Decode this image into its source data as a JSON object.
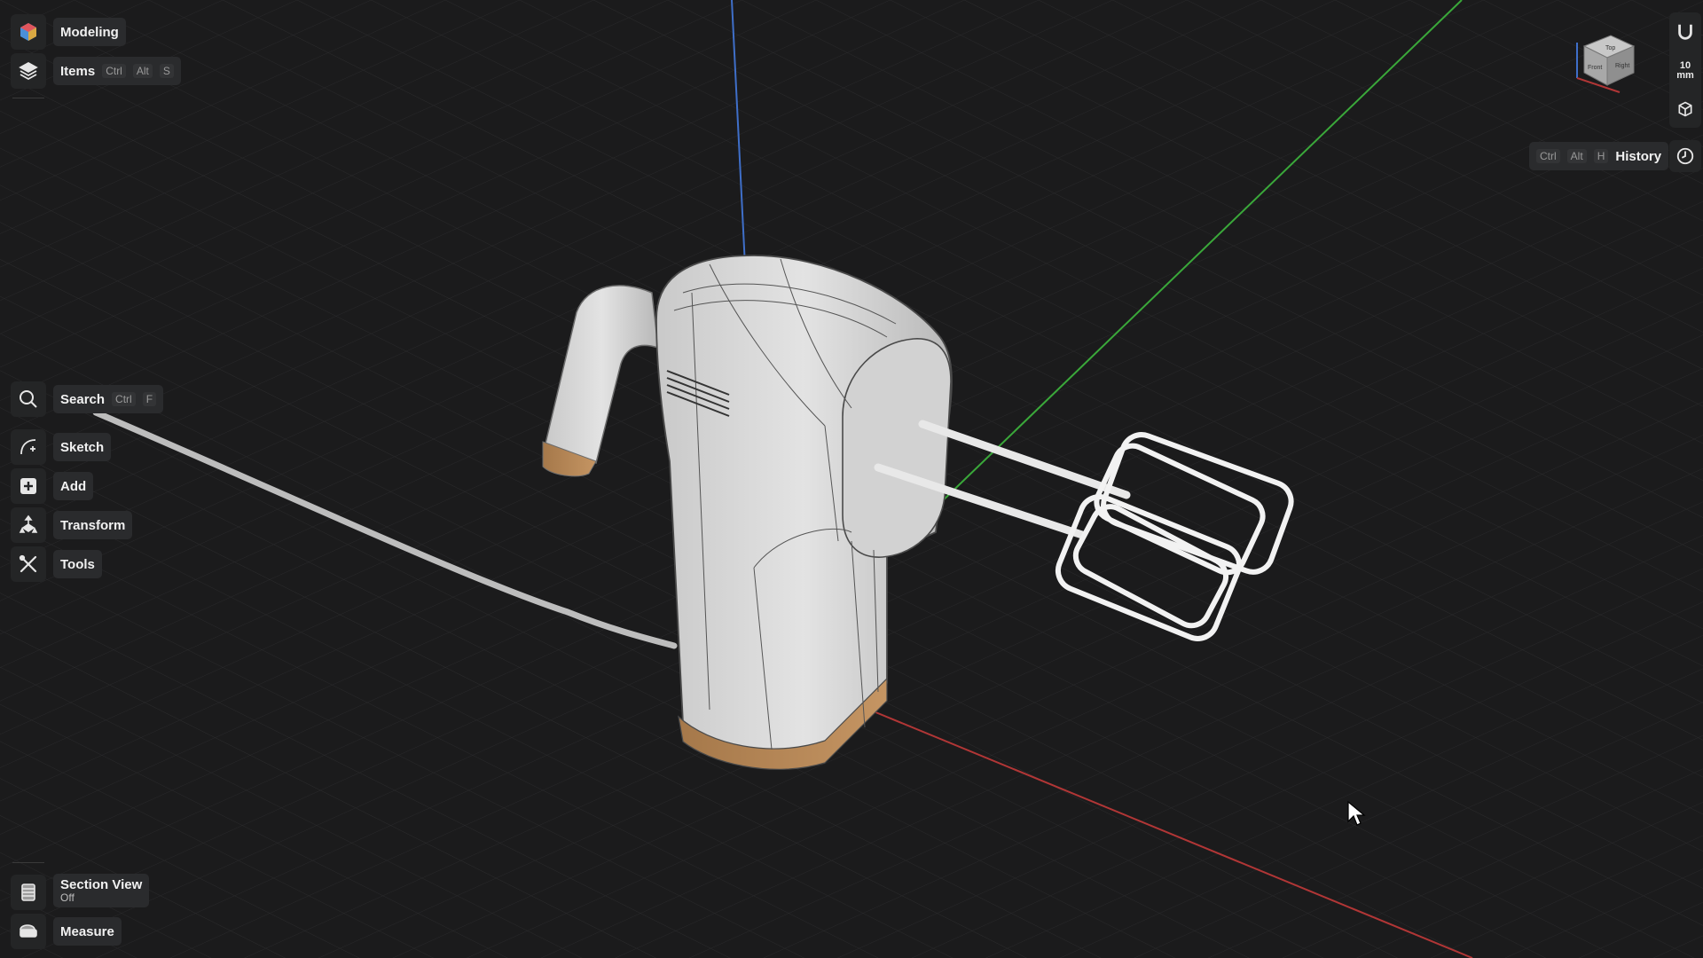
{
  "app": {
    "mode_label": "Modeling"
  },
  "items": {
    "label": "Items",
    "shortcut": [
      "Ctrl",
      "Alt",
      "S"
    ]
  },
  "search": {
    "label": "Search",
    "shortcut": [
      "Ctrl",
      "F"
    ]
  },
  "tools": [
    {
      "label": "Sketch",
      "icon": "sketch-icon"
    },
    {
      "label": "Add",
      "icon": "add-icon"
    },
    {
      "label": "Transform",
      "icon": "transform-icon"
    },
    {
      "label": "Tools",
      "icon": "tools-icon"
    }
  ],
  "section_view": {
    "label": "Section View",
    "state": "Off"
  },
  "measure": {
    "label": "Measure"
  },
  "history": {
    "label": "History",
    "shortcut": [
      "Ctrl",
      "Alt",
      "H"
    ]
  },
  "units": {
    "value": "10",
    "unit": "mm"
  },
  "viewcube": {
    "faces": [
      "Top",
      "Front",
      "Right"
    ]
  },
  "colors": {
    "background": "#1b1b1c",
    "grid": "#2c2c2e",
    "axis_x": "#b13636",
    "axis_y": "#3aa83a",
    "axis_z": "#3f6fc9",
    "model_body": "#d6d6d6",
    "model_base": "#b48654"
  }
}
